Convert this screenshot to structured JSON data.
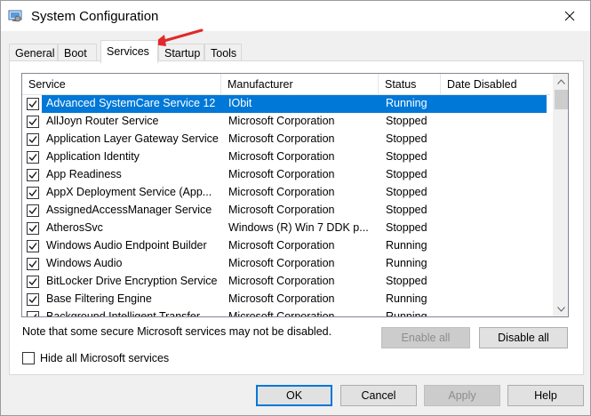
{
  "window": {
    "title": "System Configuration"
  },
  "tabs": [
    {
      "label": "General"
    },
    {
      "label": "Boot"
    },
    {
      "label": "Services"
    },
    {
      "label": "Startup"
    },
    {
      "label": "Tools"
    }
  ],
  "columns": {
    "service": "Service",
    "manufacturer": "Manufacturer",
    "status": "Status",
    "date_disabled": "Date Disabled"
  },
  "rows": [
    {
      "service": "Advanced SystemCare Service 12",
      "manufacturer": "IObit",
      "status": "Running",
      "date_disabled": ""
    },
    {
      "service": "AllJoyn Router Service",
      "manufacturer": "Microsoft Corporation",
      "status": "Stopped",
      "date_disabled": ""
    },
    {
      "service": "Application Layer Gateway Service",
      "manufacturer": "Microsoft Corporation",
      "status": "Stopped",
      "date_disabled": ""
    },
    {
      "service": "Application Identity",
      "manufacturer": "Microsoft Corporation",
      "status": "Stopped",
      "date_disabled": ""
    },
    {
      "service": "App Readiness",
      "manufacturer": "Microsoft Corporation",
      "status": "Stopped",
      "date_disabled": ""
    },
    {
      "service": "AppX Deployment Service (App...",
      "manufacturer": "Microsoft Corporation",
      "status": "Stopped",
      "date_disabled": ""
    },
    {
      "service": "AssignedAccessManager Service",
      "manufacturer": "Microsoft Corporation",
      "status": "Stopped",
      "date_disabled": ""
    },
    {
      "service": "AtherosSvc",
      "manufacturer": "Windows (R) Win 7 DDK p...",
      "status": "Stopped",
      "date_disabled": ""
    },
    {
      "service": "Windows Audio Endpoint Builder",
      "manufacturer": "Microsoft Corporation",
      "status": "Running",
      "date_disabled": ""
    },
    {
      "service": "Windows Audio",
      "manufacturer": "Microsoft Corporation",
      "status": "Running",
      "date_disabled": ""
    },
    {
      "service": "BitLocker Drive Encryption Service",
      "manufacturer": "Microsoft Corporation",
      "status": "Stopped",
      "date_disabled": ""
    },
    {
      "service": "Base Filtering Engine",
      "manufacturer": "Microsoft Corporation",
      "status": "Running",
      "date_disabled": ""
    },
    {
      "service": "Background Intelligent Transfer ...",
      "manufacturer": "Microsoft Corporation",
      "status": "Running",
      "date_disabled": ""
    }
  ],
  "note": "Note that some secure Microsoft services may not be disabled.",
  "buttons": {
    "enable_all": "Enable all",
    "disable_all": "Disable all",
    "ok": "OK",
    "cancel": "Cancel",
    "apply": "Apply",
    "help": "Help"
  },
  "hide_ms_label": "Hide all Microsoft services",
  "colors": {
    "selection": "#0078d7",
    "annotation_arrow": "#e0292b"
  }
}
